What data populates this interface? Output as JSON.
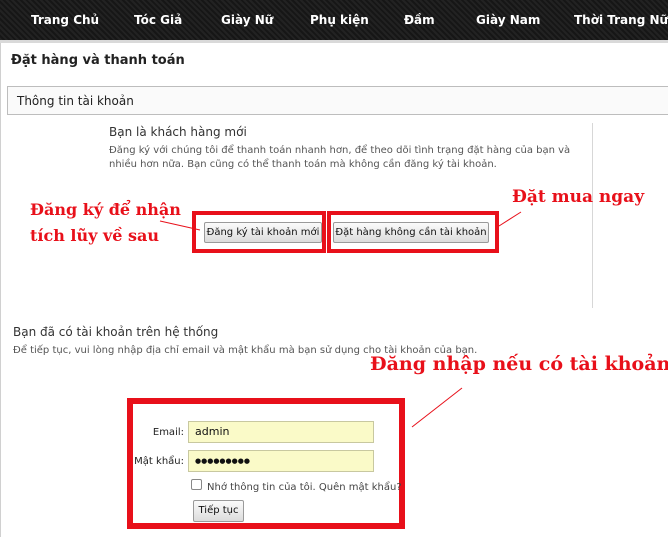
{
  "nav": {
    "items": [
      "Trang Chủ",
      "Tóc Giả",
      "Giày Nữ",
      "Phụ kiện",
      "Đầm",
      "Giày Nam",
      "Thời Trang Nữ"
    ]
  },
  "page": {
    "title": "Đặt hàng và thanh toán",
    "section_title": "Thông tin tài khoản"
  },
  "new_customer": {
    "heading": "Bạn là khách hàng mới",
    "description": "Đăng ký với chúng tôi để thanh toán nhanh hơn, để theo dõi tình trạng đặt hàng của bạn và nhiều hơn nữa. Bạn cũng có thể thanh toán mà không cần đăng ký tài khoản.",
    "register_button": "Đăng ký tài khoản mới",
    "guest_button": "Đặt hàng không cần tài khoản"
  },
  "existing_customer": {
    "heading": "Bạn đã có tài khoản trên hệ thống",
    "description": "Để tiếp tục, vui lòng nhập địa chỉ email và mật khẩu mà bạn sử dụng cho tài khoản của bạn.",
    "email_label": "Email:",
    "email_value": "admin",
    "password_label": "Mật khẩu:",
    "password_value": "●●●●●●●●●",
    "remember_label": "Nhớ thông tin của tôi.",
    "forgot_link": "Quên mật khẩu?",
    "remember_checked": false,
    "submit_button": "Tiếp tục"
  },
  "annotations": {
    "register_line1": "Đăng ký để nhận",
    "register_line2": "tích lũy về sau",
    "guest": "Đặt mua ngay",
    "login": "Đăng nhập nếu có tài khoản",
    "color": "#e8101a"
  }
}
